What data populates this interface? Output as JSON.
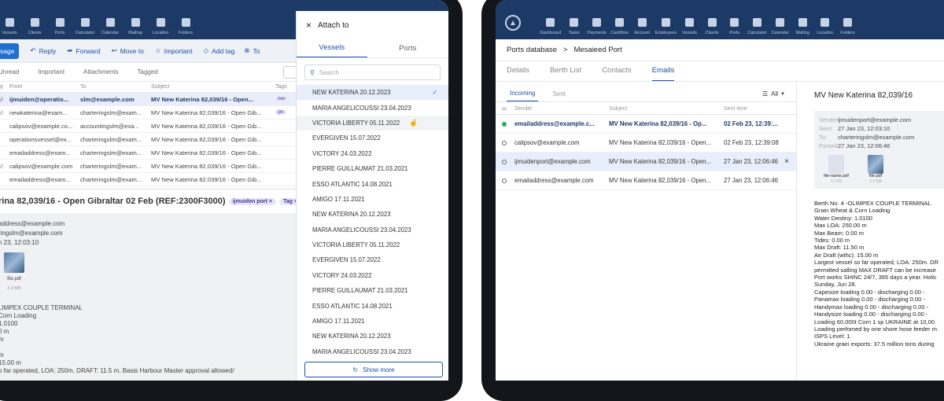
{
  "left": {
    "nav": [
      "Vessels",
      "Clients",
      "Ports",
      "Calculator",
      "Calendar",
      "Mailing",
      "Location",
      "Folders"
    ],
    "toolbar": {
      "message": "sage",
      "reply": "Reply",
      "forward": "Forward",
      "move": "Move to",
      "important": "Important",
      "addtag": "Add tag",
      "to": "To"
    },
    "filters": [
      "Unread",
      "Important",
      "Attachments",
      "Tagged"
    ],
    "cols": {
      "from": "From",
      "to": "To",
      "subject": "Subject",
      "tags": "Tags"
    },
    "rows": [
      {
        "from": "ijmuiden@operatio...",
        "to": "slm@example.com",
        "subject": "MV New Katerina 82,039/16 - Open...",
        "bold": true,
        "att": true,
        "tag": "nev"
      },
      {
        "from": "newkaterina@exam...",
        "to": "charteringslm@exam...",
        "subject": "MV New Katerina 82,039/16 - Open Gib...",
        "bold": false,
        "att": true,
        "tag": "ijm"
      },
      {
        "from": "calipsov@example.co...",
        "to": "accountingslm@exa...",
        "subject": "MV New Katerina 82,039/16 - Open Gib...",
        "bold": false,
        "att": false,
        "tag": ""
      },
      {
        "from": "operationsvessel@ex...",
        "to": "charteringslm@exam...",
        "subject": "MV New Katerina 82,039/16 - Open Gib...",
        "bold": false,
        "att": false,
        "tag": ""
      },
      {
        "from": "emailaddress@exam...",
        "to": "charteringslm@exam...",
        "subject": "MV New Katerina 82,039/16 - Open Gib...",
        "bold": false,
        "att": false,
        "tag": ""
      },
      {
        "from": "calipsov@example.com",
        "to": "charteringslm@exam...",
        "subject": "MV New Katerina 82,039/16 - Open Gib...",
        "bold": false,
        "att": true,
        "tag": ""
      },
      {
        "from": "emailaddress@exam...",
        "to": "charteringslm@exam...",
        "subject": "MV New Katerina 82,039/16 - Open Gib...",
        "bold": false,
        "att": false,
        "tag": ""
      }
    ],
    "detail_title": "rina 82,039/16 - Open Gibraltar 02 Feb (REF:2300F3000)",
    "detail_tags": [
      "ijmuiden port",
      "Tag"
    ],
    "meta": [
      "address@example.com",
      "ringslm@example.com",
      "n 23, 12:03:10"
    ],
    "file": {
      "name": "file.pdf",
      "size": "2.4 MB"
    },
    "body": [
      "LIMPEX COUPLE TERMINAL",
      "Corn Loading",
      "1.0100",
      "0 m",
      "m",
      "",
      "m",
      "15.00 m",
      "o far operated, LOA: 250m. DRAFT: 11.5 m. Basis Harbour Master approval allowed/"
    ]
  },
  "attach": {
    "title": "Attach to",
    "tabs": [
      "Vessels",
      "Ports"
    ],
    "search": "Search",
    "items": [
      "NEW KATERINA 20.12.2023",
      "MARIA ANGELICOUSSI 23.04.2023",
      "VICTORIA LIBERTY 05.11.2022",
      "EVERGIVEN 15.07.2022",
      "VICTORY 24.03.2022",
      "PIERRE GUILLAUMAT 21.03.2021",
      "ESSO ATLANTIC 14.08.2021",
      "AMIGO 17.11.2021",
      "NEW KATERINA 20.12.2023",
      "MARIA ANGELICOUSSI 23.04.2023",
      "VICTORIA LIBERTY 05.11.2022",
      "EVERGIVEN 15.07.2022",
      "VICTORY 24.03.2022",
      "PIERRE GUILLAUMAT 21.03.2021",
      "ESSO ATLANTIC 14.08.2021",
      "AMIGO 17.11.2021",
      "NEW KATERINA 20.12.2023",
      "MARIA ANGELICOUSSI 23.04.2023"
    ],
    "show_more": "Show more"
  },
  "right": {
    "nav": [
      "Dashboard",
      "Tasks",
      "Payments",
      "Cashflow",
      "Account",
      "Employees",
      "Vessels",
      "Clients",
      "Ports",
      "Calculator",
      "Calendar",
      "Mailing",
      "Location",
      "Folders"
    ],
    "breadcrumb": [
      "Ports database",
      "Mesaieed Port"
    ],
    "tabs": [
      "Details",
      "Berth List",
      "Contacts",
      "Emails"
    ],
    "subtabs": [
      "Incoming",
      "Sent"
    ],
    "filter": "All",
    "cols": {
      "sender": "Sender",
      "subject": "Subject",
      "sent": "Sent time"
    },
    "rows": [
      {
        "sender": "emailaddress@example.c...",
        "subject": "MV New Katerina 82,039/16 - Op...",
        "time": "02 Feb 23, 12:39:...",
        "bold": true
      },
      {
        "sender": "calipsov@example.com",
        "subject": "MV New Katerina 82,039/16 - Open...",
        "time": "02 Feb 23, 12:39:08",
        "bold": false
      },
      {
        "sender": "ijmuidenport@example.com",
        "subject": "MV New Katerina 82,039/16 - Open...",
        "time": "27 Jan 23, 12:06:46",
        "bold": false
      },
      {
        "sender": "emailaddress@example.com",
        "subject": "MV New Katerina 82,039/16 - Open...",
        "time": "27 Jan 23, 12:06:46",
        "bold": false
      }
    ],
    "detail_title": "MV New Katerina 82,039/16",
    "meta": [
      [
        "Sender:",
        "ijmuidenport@example.com"
      ],
      [
        "Sent:",
        "27 Jan 23, 12:03:10"
      ],
      [
        "To:",
        "charteringslm@example.com"
      ],
      [
        "Parsed:",
        "27 Jan 23, 12:06:46"
      ]
    ],
    "files": [
      {
        "name": "file-name.pdf",
        "size": "17 KB"
      },
      {
        "name": "file.pdf",
        "size": "2.4 MB"
      }
    ],
    "body": [
      "Berth No. 4 -OLIMPEX COUPLE TERMINAL",
      "Grain Wheat & Corn Loading",
      "Water Destiny: 1.0100",
      "Max LOA: 250.00 m",
      "Max Beam: 0.00 m",
      "Tides: 0.00 m",
      "Max Draft: 11.50 m",
      "Air Draft (wthc): 15.00 m",
      "Largest vessel so far operated, LOA: 250m. DR",
      "permitted salling MAX DRAFT can be increase",
      "Port works SHINC 24/7, 365 days a year. Holic",
      "Sunday, Jun 28.",
      "Capesize loading 0.00 - discharging 0.00 -",
      "Panamax loading 0.00 - discharging 0.00 -",
      "Handymax loading 0.00 - discharging 0.00 -",
      "Handysize loading 0.00 - discharging 0.00 -",
      "Loading 60,000t Corn 1 sp UKRAINE at 10,00",
      "Loading perfomed by one shore hose feeder m",
      "ISPS Level: 1.",
      "Ukraine grain exports: 37.5 million tons during"
    ]
  },
  "colors": {
    "navy": "#1d3a66",
    "accent": "#1f4ea8",
    "green": "#22b35a"
  }
}
